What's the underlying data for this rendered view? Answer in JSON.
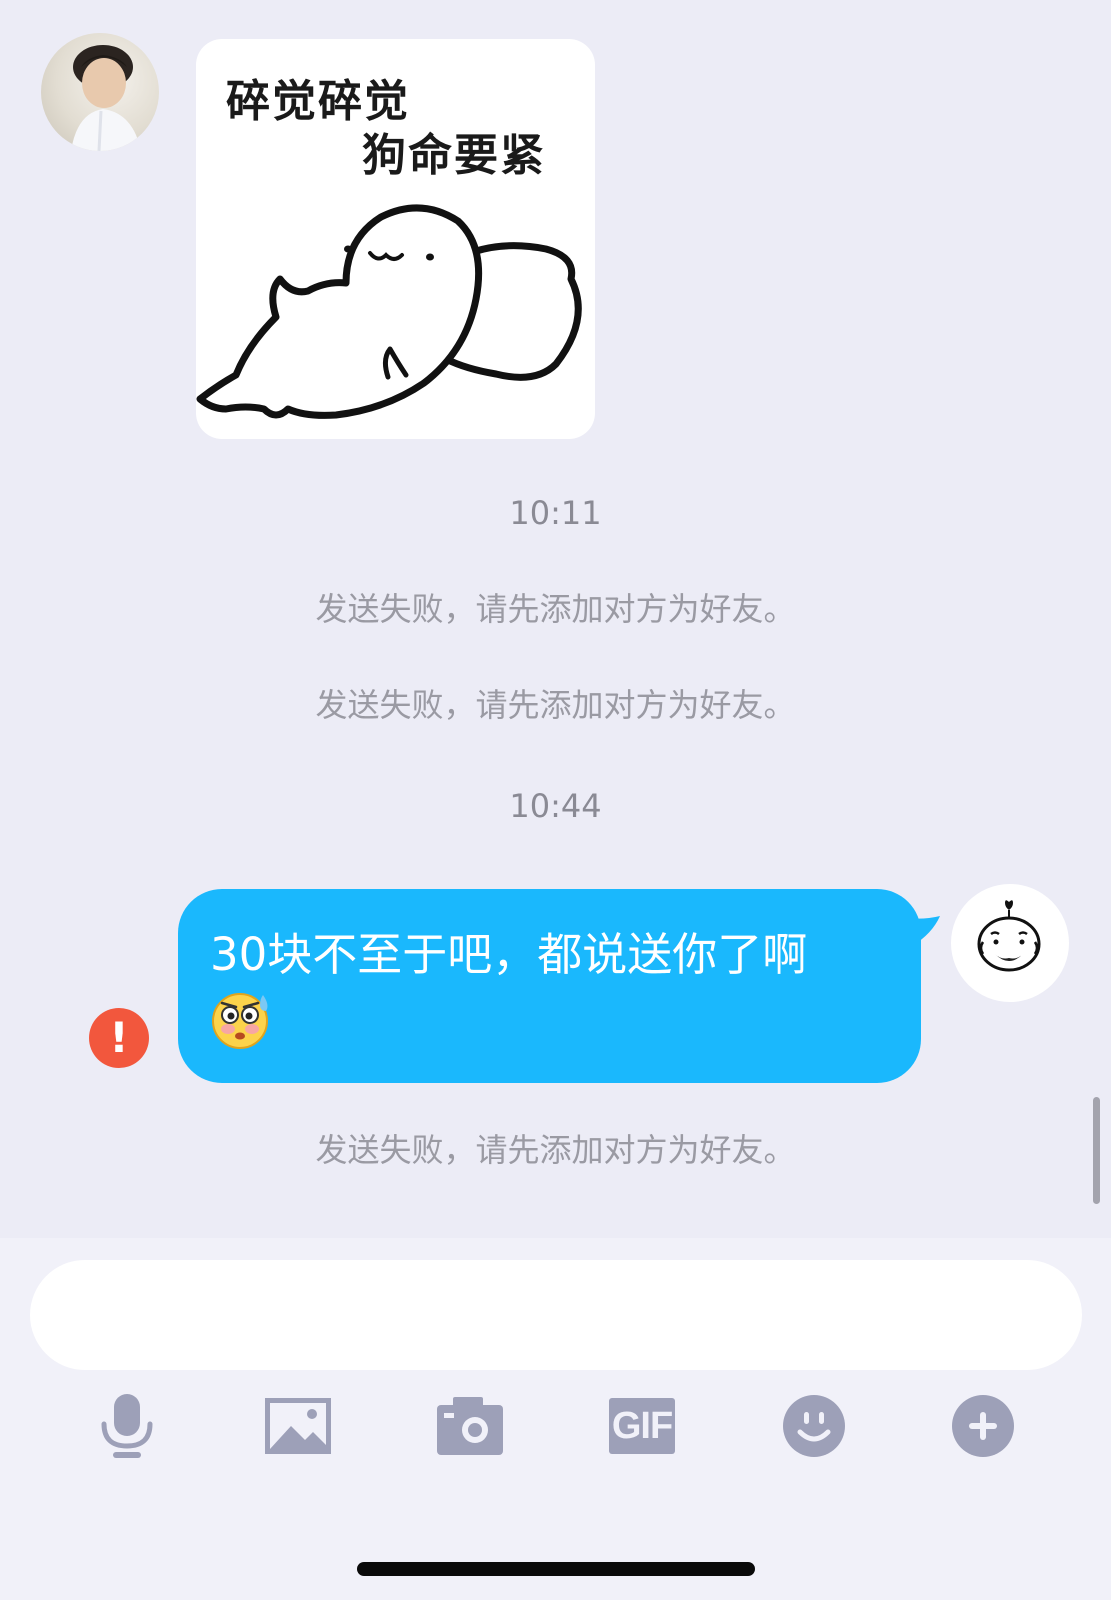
{
  "messages": {
    "sticker": {
      "line1": "碎觉碎觉",
      "line2": "狗命要紧"
    },
    "timestamp_1": "10:11",
    "system_1": "发送失败，请先添加对方为好友。",
    "system_2": "发送失败，请先添加对方为好友。",
    "timestamp_2": "10:44",
    "outgoing_text": "30块不至于吧，都说送你了啊",
    "outgoing_emoji": "flushed-sweat-emoji",
    "system_3": "发送失败，请先添加对方为好友。",
    "fail_icon_glyph": "!"
  },
  "input": {
    "value": "",
    "placeholder": ""
  },
  "toolbar": {
    "icons": [
      "microphone-icon",
      "image-icon",
      "camera-icon",
      "gif-icon",
      "emoji-icon",
      "plus-icon"
    ],
    "gif_label": "GIF"
  },
  "colors": {
    "background": "#ececf6",
    "outgoing_bubble": "#1ab8fd",
    "fail_icon": "#f2573d",
    "toolbar_icon": "#9da0b8"
  }
}
